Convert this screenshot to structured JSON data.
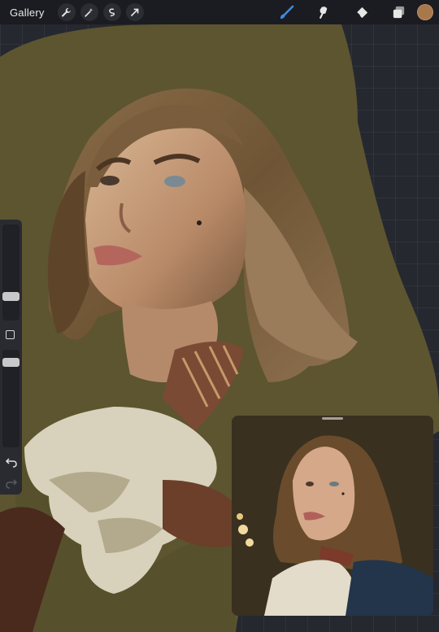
{
  "toolbar": {
    "gallery_label": "Gallery",
    "left_icons": [
      "wrench-icon",
      "magic-wand-icon",
      "selection-icon",
      "transform-arrow-icon"
    ],
    "right_icons": [
      "brush-icon",
      "smudge-icon",
      "eraser-icon",
      "layers-icon"
    ],
    "active_tool": "brush",
    "active_tool_color": "#3a8ee6",
    "current_color": "#a8774a"
  },
  "sidebar": {
    "controls": [
      "brush-size-slider",
      "modify-button",
      "opacity-slider",
      "undo-button",
      "redo-button"
    ]
  },
  "canvas": {
    "paint_background": "#5b5430"
  }
}
